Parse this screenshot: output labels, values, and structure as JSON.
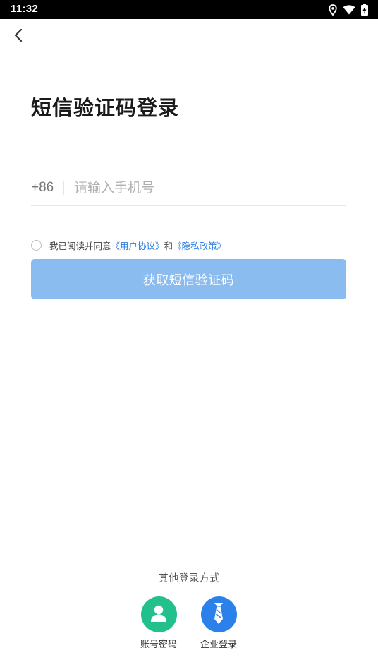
{
  "status_bar": {
    "time": "11:32",
    "icons": [
      "location-icon",
      "wifi-icon",
      "battery-charging-icon"
    ]
  },
  "header": {
    "back_icon": "chevron-left-icon"
  },
  "title": "短信验证码登录",
  "phone": {
    "country_code": "+86",
    "placeholder": "请输入手机号",
    "value": ""
  },
  "agreement": {
    "prefix": "我已阅读并同意",
    "user_agreement": "《用户协议》",
    "conjunction": "和",
    "privacy_policy": "《隐私政策》",
    "checked": false
  },
  "submit": {
    "label": "获取短信验证码",
    "color": "#8bbcf0"
  },
  "other_login": {
    "label": "其他登录方式",
    "options": [
      {
        "label": "账号密码",
        "icon": "user-icon",
        "color": "#22c08c"
      },
      {
        "label": "企业登录",
        "icon": "necktie-icon",
        "color": "#2b80ea"
      }
    ]
  },
  "colors": {
    "link": "#2b7fe0"
  }
}
